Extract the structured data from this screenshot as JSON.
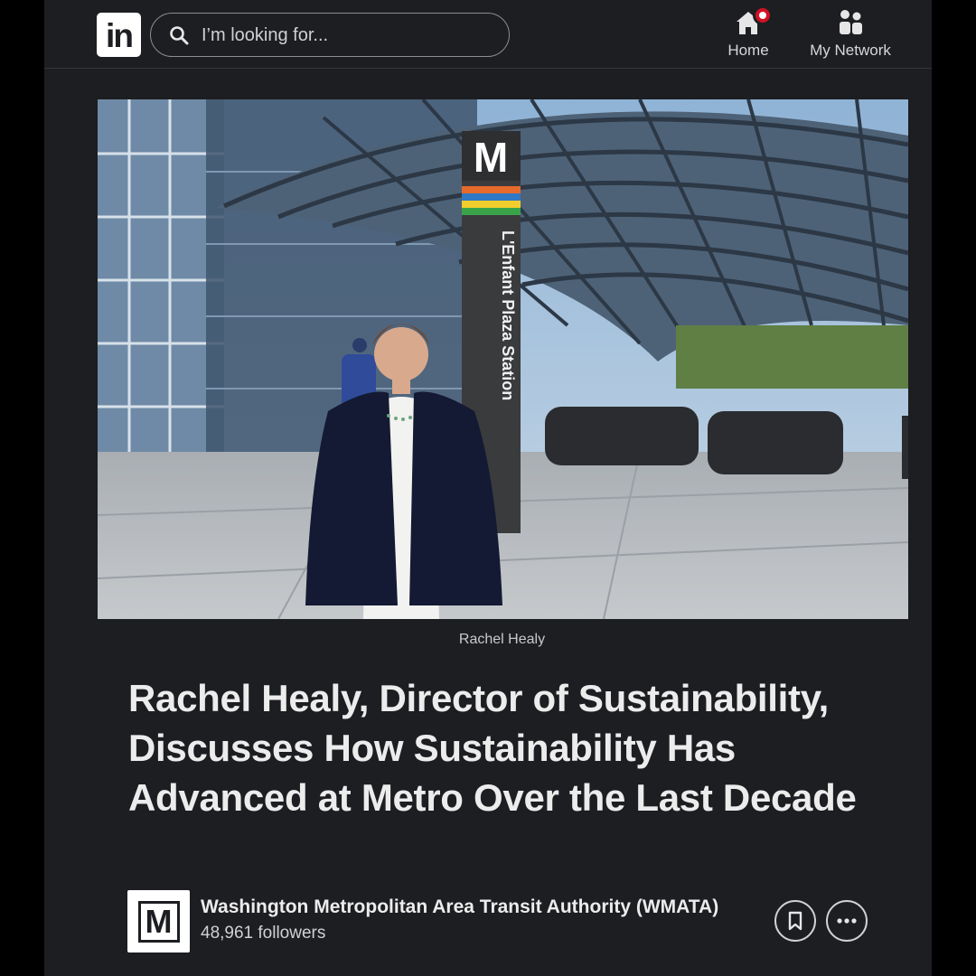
{
  "header": {
    "logo_text": "in",
    "search_placeholder": "I’m looking for...",
    "nav": [
      {
        "label": "Home",
        "icon": "home-icon",
        "has_notification": true
      },
      {
        "label": "My Network",
        "icon": "network-icon"
      }
    ]
  },
  "article": {
    "image_caption": "Rachel Healy",
    "station_sign": {
      "letter": "M",
      "name": "L'Enfant Plaza Station"
    },
    "title": "Rachel Healy, Director of Sustainability, Discusses How Sustainability Has Advanced at Metro Over the Last Decade"
  },
  "author": {
    "logo_letter": "M",
    "name": "Washington Metropolitan Area Transit Authority (WMATA)",
    "followers": "48,961 followers",
    "actions": [
      {
        "icon": "bookmark-icon"
      },
      {
        "icon": "more-options-icon"
      }
    ]
  },
  "colors": {
    "background": "#1d1e21",
    "notification": "#d11124",
    "text": "#ececed"
  }
}
